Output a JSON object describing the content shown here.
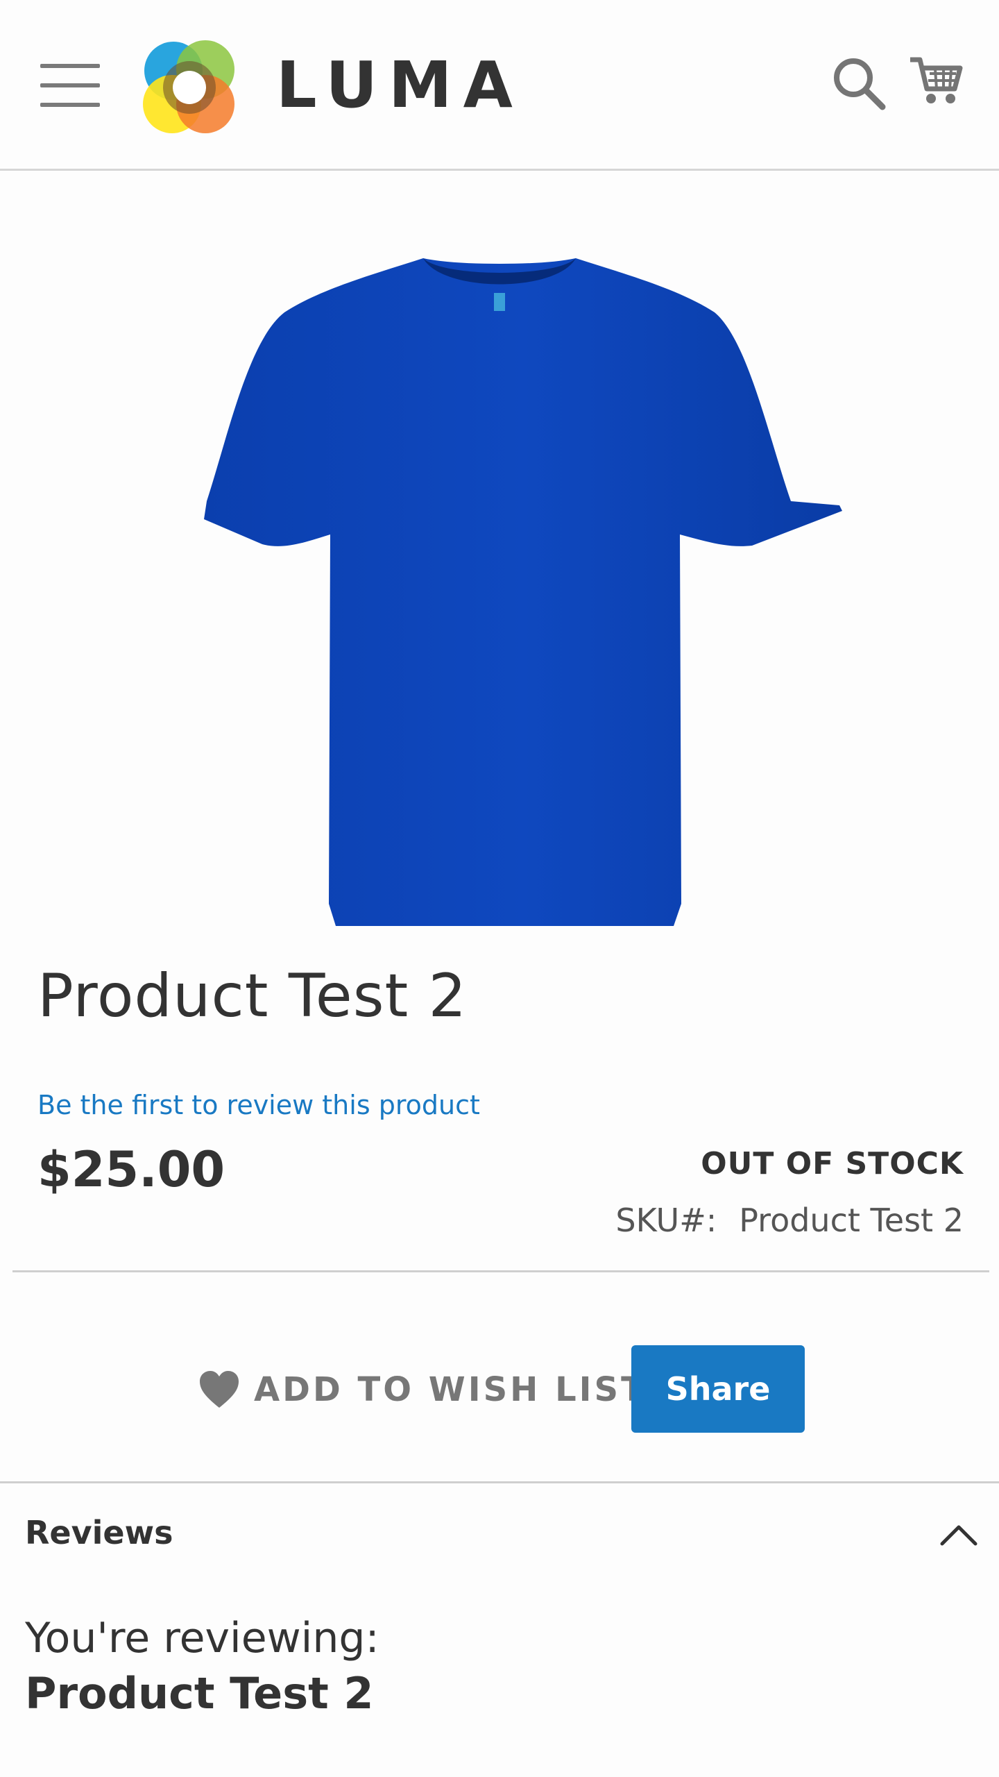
{
  "header": {
    "brand": "LUMA"
  },
  "product": {
    "title": "Product Test 2",
    "review_link": "Be the first to review this product",
    "price": "$25.00",
    "stock_status": "OUT OF STOCK",
    "sku_label": "SKU#:",
    "sku_value": "Product Test 2",
    "image_color": "#0d45b8"
  },
  "actions": {
    "wishlist_label": "ADD TO WISH LIST",
    "share_label": "Share"
  },
  "reviews": {
    "title": "Reviews",
    "reviewing_label": "You're reviewing:",
    "reviewing_product": "Product Test 2"
  },
  "colors": {
    "accent": "#1979c3",
    "text": "#333333",
    "muted": "#777777"
  }
}
